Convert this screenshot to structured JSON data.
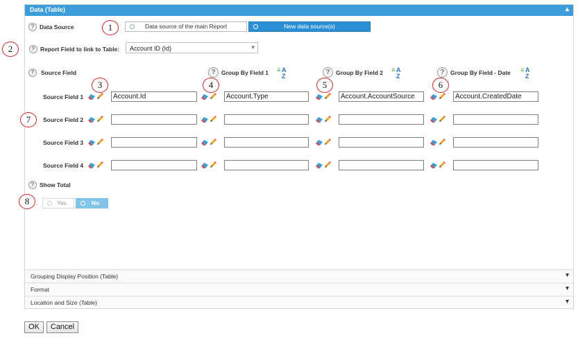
{
  "panel": {
    "title": "Data (Table)"
  },
  "data_source": {
    "label": "Data Source",
    "options": [
      "Data source of the main Report",
      "New data source(s)"
    ],
    "selected": "New data source(s)"
  },
  "report_field": {
    "label": "Report Field to link to Table:",
    "value": "Account ID (Id)"
  },
  "columns": {
    "source_field": "Source Field",
    "group1": "Group By Field 1",
    "group2": "Group By Field 2",
    "group_date": "Group By Field - Date"
  },
  "rows": [
    {
      "label": "Source Field 1",
      "values": [
        "Account.Id",
        "Account.Type",
        "Account.AccountSource",
        "Account.CreatedDate"
      ]
    },
    {
      "label": "Source Field 2",
      "values": [
        "",
        "",
        "",
        ""
      ]
    },
    {
      "label": "Source Field 3",
      "values": [
        "",
        "",
        "",
        ""
      ]
    },
    {
      "label": "Source Field 4",
      "values": [
        "",
        "",
        "",
        ""
      ]
    }
  ],
  "show_total": {
    "label": "Show Total",
    "options": [
      "Yes",
      "No"
    ],
    "selected": "No"
  },
  "sections": [
    "Grouping Display Position (Table)",
    "Format",
    "Location and Size (Table)"
  ],
  "callouts": [
    "1",
    "2",
    "3",
    "4",
    "5",
    "6",
    "7",
    "8"
  ],
  "buttons": {
    "ok": "OK",
    "cancel": "Cancel"
  },
  "icons": {
    "help": "?",
    "expand": "▾",
    "collapse": "▴"
  },
  "colors": {
    "header": "#3d9ddb",
    "selected": "#2b8fd6",
    "callout_border": "#d02020"
  }
}
